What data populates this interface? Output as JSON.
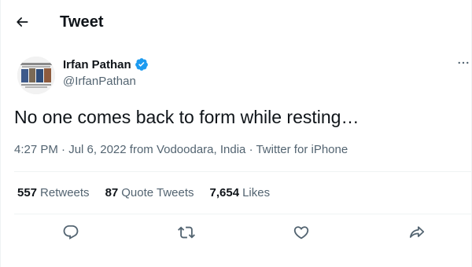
{
  "header": {
    "title": "Tweet",
    "back_icon": "arrow-left-icon"
  },
  "tweet": {
    "author": {
      "display_name": "Irfan Pathan",
      "handle": "@IrfanPathan",
      "verified": true,
      "verified_color": "#1d9bf0"
    },
    "text": "No one comes back to form while resting…",
    "meta": {
      "time": "4:27 PM",
      "date": "Jul 6, 2022",
      "location": "from Vodoodara, India",
      "source": "Twitter for iPhone",
      "separator": "·"
    },
    "stats": [
      {
        "count": "557",
        "label": "Retweets"
      },
      {
        "count": "87",
        "label": "Quote Tweets"
      },
      {
        "count": "7,654",
        "label": "Likes"
      }
    ],
    "actions": [
      {
        "name": "reply",
        "icon": "reply-icon"
      },
      {
        "name": "retweet",
        "icon": "retweet-icon"
      },
      {
        "name": "like",
        "icon": "heart-icon"
      },
      {
        "name": "share",
        "icon": "share-icon"
      }
    ]
  },
  "colors": {
    "text_primary": "#0f1419",
    "text_secondary": "#536471",
    "divider": "#eff3f4",
    "icon": "#536471"
  }
}
